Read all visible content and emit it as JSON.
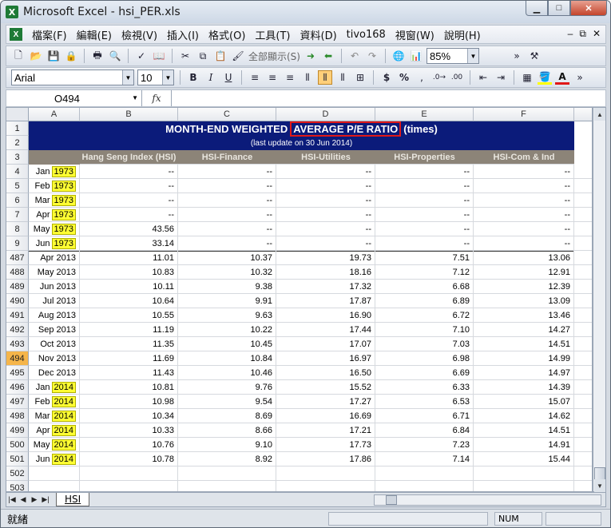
{
  "window": {
    "title": "Microsoft Excel - hsi_PER.xls",
    "app_icon_letter": "X"
  },
  "menu": {
    "items": [
      "檔案(F)",
      "編輯(E)",
      "檢視(V)",
      "插入(I)",
      "格式(O)",
      "工具(T)",
      "資料(D)",
      "tivo168",
      "視窗(W)",
      "說明(H)"
    ]
  },
  "toolbar": {
    "show_all": "全部顯示(S)",
    "zoom": "85%",
    "font_name": "Arial",
    "font_size": "10",
    "bold": "B",
    "italic": "I",
    "underline": "U",
    "currency": "$",
    "percent": "%"
  },
  "formula_bar": {
    "name_box": "O494",
    "fx": "fx",
    "formula": ""
  },
  "columns": [
    "A",
    "B",
    "C",
    "D",
    "E",
    "F"
  ],
  "sheet": {
    "title_pre": "MONTH-END WEIGHTED",
    "title_highlight": "AVERAGE P/E RATIO",
    "title_post": "(times)",
    "subtitle": "(last update on 30 Jun 2014)",
    "headers": [
      "Hang Seng Index (HSI)",
      "HSI-Finance",
      "HSI-Utilities",
      "HSI-Properties",
      "HSI-Com & Ind"
    ],
    "top_rows": [
      {
        "row": "4",
        "month": "Jan",
        "year": "1973",
        "vals": [
          "--",
          "--",
          "--",
          "--",
          "--"
        ]
      },
      {
        "row": "5",
        "month": "Feb",
        "year": "1973",
        "vals": [
          "--",
          "--",
          "--",
          "--",
          "--"
        ]
      },
      {
        "row": "6",
        "month": "Mar",
        "year": "1973",
        "vals": [
          "--",
          "--",
          "--",
          "--",
          "--"
        ]
      },
      {
        "row": "7",
        "month": "Apr",
        "year": "1973",
        "vals": [
          "--",
          "--",
          "--",
          "--",
          "--"
        ]
      },
      {
        "row": "8",
        "month": "May",
        "year": "1973",
        "vals": [
          "43.56",
          "--",
          "--",
          "--",
          "--"
        ]
      },
      {
        "row": "9",
        "month": "Jun",
        "year": "1973",
        "vals": [
          "33.14",
          "--",
          "--",
          "--",
          "--"
        ]
      }
    ],
    "bottom_rows": [
      {
        "row": "487",
        "label": "Apr 2013",
        "vals": [
          "11.01",
          "10.37",
          "19.73",
          "7.51",
          "13.06"
        ]
      },
      {
        "row": "488",
        "label": "May 2013",
        "vals": [
          "10.83",
          "10.32",
          "18.16",
          "7.12",
          "12.91"
        ]
      },
      {
        "row": "489",
        "label": "Jun 2013",
        "vals": [
          "10.11",
          "9.38",
          "17.32",
          "6.68",
          "12.39"
        ]
      },
      {
        "row": "490",
        "label": "Jul 2013",
        "vals": [
          "10.64",
          "9.91",
          "17.87",
          "6.89",
          "13.09"
        ]
      },
      {
        "row": "491",
        "label": "Aug 2013",
        "vals": [
          "10.55",
          "9.63",
          "16.90",
          "6.72",
          "13.46"
        ]
      },
      {
        "row": "492",
        "label": "Sep 2013",
        "vals": [
          "11.19",
          "10.22",
          "17.44",
          "7.10",
          "14.27"
        ]
      },
      {
        "row": "493",
        "label": "Oct 2013",
        "vals": [
          "11.35",
          "10.45",
          "17.07",
          "7.03",
          "14.51"
        ]
      },
      {
        "row": "494",
        "label": "Nov 2013",
        "vals": [
          "11.69",
          "10.84",
          "16.97",
          "6.98",
          "14.99"
        ]
      },
      {
        "row": "495",
        "label": "Dec 2013",
        "vals": [
          "11.43",
          "10.46",
          "16.50",
          "6.69",
          "14.97"
        ]
      },
      {
        "row": "496",
        "month": "Jan",
        "year": "2014",
        "vals": [
          "10.81",
          "9.76",
          "15.52",
          "6.33",
          "14.39"
        ]
      },
      {
        "row": "497",
        "month": "Feb",
        "year": "2014",
        "vals": [
          "10.98",
          "9.54",
          "17.27",
          "6.53",
          "15.07"
        ]
      },
      {
        "row": "498",
        "month": "Mar",
        "year": "2014",
        "vals": [
          "10.34",
          "8.69",
          "16.69",
          "6.71",
          "14.62"
        ]
      },
      {
        "row": "499",
        "month": "Apr",
        "year": "2014",
        "vals": [
          "10.33",
          "8.66",
          "17.21",
          "6.84",
          "14.51"
        ]
      },
      {
        "row": "500",
        "month": "May",
        "year": "2014",
        "vals": [
          "10.76",
          "9.10",
          "17.73",
          "7.23",
          "14.91"
        ]
      },
      {
        "row": "501",
        "month": "Jun",
        "year": "2014",
        "vals": [
          "10.78",
          "8.92",
          "17.86",
          "7.14",
          "15.44"
        ]
      },
      {
        "row": "502"
      },
      {
        "row": "503"
      }
    ],
    "header_rows": [
      "1",
      "2",
      "3"
    ],
    "selected_row": "494"
  },
  "tabs": {
    "sheet_name": "HSI"
  },
  "status": {
    "ready": "就緒",
    "num": "NUM"
  },
  "colors": {
    "title_bg": "#0b1b7a",
    "header_bg": "#8c8478",
    "year_highlight": "#ffff33",
    "selected_row": "#f5b54a"
  }
}
